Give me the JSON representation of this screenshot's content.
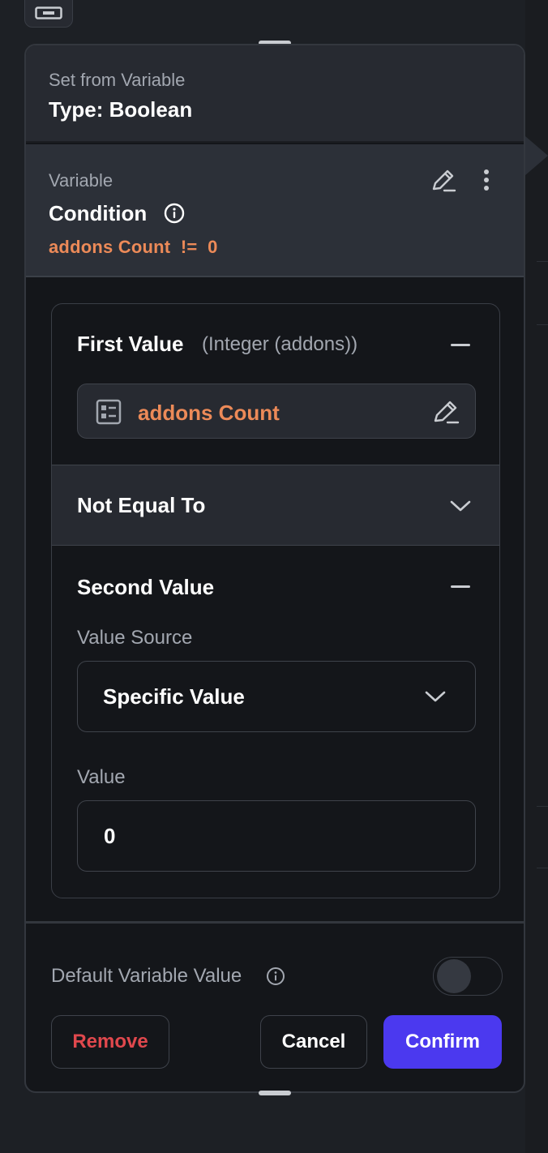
{
  "header": {
    "section_label": "Set from Variable",
    "type_line": "Type: Boolean"
  },
  "variable": {
    "label": "Variable",
    "title": "Condition",
    "expression": "addons Count  !=  0"
  },
  "condition": {
    "first_value": {
      "title": "First Value",
      "type_hint": "(Integer (addons))",
      "variable_name": "addons Count"
    },
    "operator": {
      "selected": "Not Equal To"
    },
    "second_value": {
      "title": "Second Value",
      "value_source_label": "Value Source",
      "value_source_selected": "Specific Value",
      "value_label": "Value",
      "value": "0"
    }
  },
  "footer": {
    "default_value_label": "Default Variable Value",
    "default_value_enabled": false,
    "remove_label": "Remove",
    "cancel_label": "Cancel",
    "confirm_label": "Confirm"
  },
  "colors": {
    "accent_orange": "#ec8a58",
    "confirm_purple": "#4b39ef",
    "remove_red": "#e0484d",
    "panel_bg": "#14161a"
  },
  "icons": {
    "top_tile": "variable-card-icon",
    "condition_info": "info-icon",
    "edit": "pencil-edit-icon",
    "more": "kebab-menu-icon",
    "variable_chip": "table-list-icon",
    "collapse": "minus-icon",
    "dropdown": "chevron-down-icon"
  }
}
